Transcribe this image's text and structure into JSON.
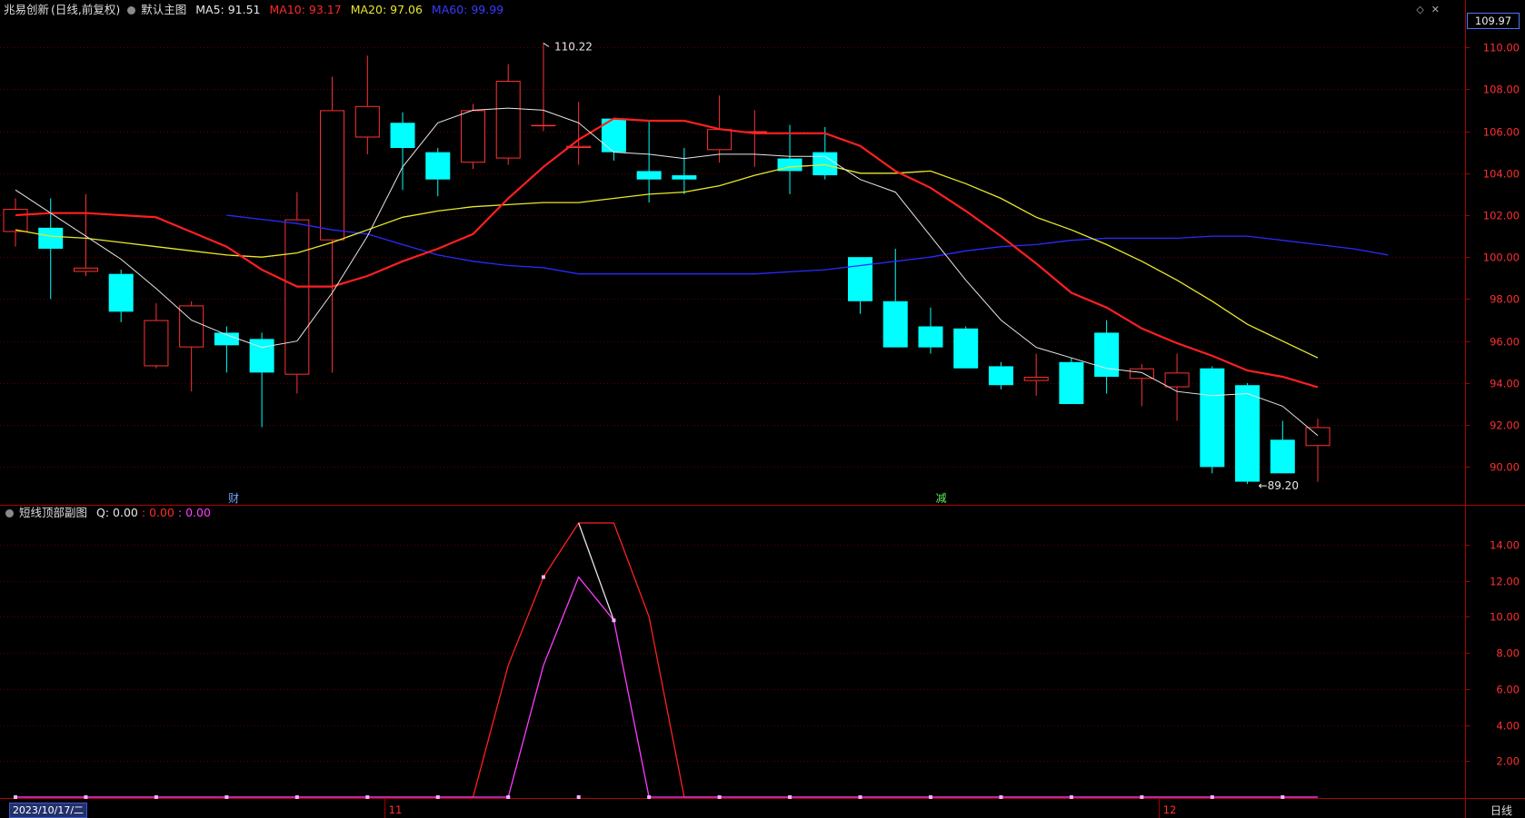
{
  "header_main": {
    "stock_name": "兆易创新",
    "mode": "(日线,前复权)",
    "template": "默认主图",
    "ma5": "MA5: 91.51",
    "ma10": "MA10: 93.17",
    "ma20": "MA20: 97.06",
    "ma60": "MA60: 99.99"
  },
  "header_sub": {
    "title": "短线顶部副图",
    "q": "Q: 0.00",
    "v2": ": 0.00",
    "v3": ": 0.00"
  },
  "price_box": "109.97",
  "date_box": "2023/10/17/二",
  "period_box": "日线",
  "annotations": {
    "high": "110.22",
    "low": "89.20",
    "marker1": "财",
    "marker2": "减"
  },
  "colors": {
    "up": "#ff3232",
    "down": "#00ffff",
    "ma5": "#e6e6e6",
    "ma10": "#ff2020",
    "ma20": "#e8e82a",
    "ma60": "#2a2aff",
    "sub_red": "#ff2020",
    "sub_magenta": "#ff3cff",
    "grid": "#5a0000",
    "axis": "#b00000"
  },
  "chart_data": [
    {
      "type": "candlestick",
      "x": [
        1,
        2,
        3,
        4,
        5,
        6,
        7,
        8,
        9,
        10,
        11,
        12,
        13,
        14,
        15,
        16,
        17,
        18,
        19,
        20,
        21,
        22,
        23,
        24,
        25,
        26,
        27,
        28,
        29,
        30,
        31,
        32,
        33,
        34,
        35,
        36,
        37,
        38
      ],
      "month_labels": [
        {
          "at": 11.5,
          "label": "11"
        },
        {
          "at": 33.5,
          "label": "12"
        }
      ],
      "open": [
        101.2,
        101.4,
        99.3,
        99.2,
        94.8,
        95.7,
        96.4,
        96.1,
        94.4,
        100.8,
        105.7,
        106.4,
        105.0,
        104.5,
        104.7,
        106.3,
        105.2,
        106.6,
        104.1,
        103.9,
        105.1,
        106.0,
        104.7,
        105.0,
        100.0,
        97.9,
        96.7,
        96.6,
        94.8,
        94.1,
        95.0,
        96.4,
        94.2,
        93.8,
        94.7,
        93.9,
        91.3,
        91.0
      ],
      "close": [
        102.3,
        100.4,
        99.5,
        97.4,
        97.0,
        97.7,
        95.8,
        94.5,
        101.8,
        107.0,
        107.2,
        105.2,
        103.7,
        107.0,
        108.4,
        106.3,
        105.3,
        105.0,
        103.7,
        103.7,
        106.1,
        106.0,
        104.1,
        103.9,
        97.9,
        95.7,
        95.7,
        94.7,
        93.9,
        94.3,
        93.0,
        94.3,
        94.7,
        94.5,
        90.0,
        89.3,
        89.7,
        91.9
      ],
      "high": [
        102.8,
        102.8,
        103.0,
        99.4,
        97.8,
        97.9,
        96.7,
        96.4,
        103.1,
        108.6,
        109.6,
        106.9,
        105.2,
        107.3,
        109.2,
        110.2,
        107.4,
        106.4,
        106.5,
        105.2,
        107.7,
        107.0,
        106.3,
        106.2,
        100.0,
        100.4,
        97.6,
        96.7,
        95.0,
        95.4,
        95.2,
        97.0,
        94.9,
        95.4,
        94.8,
        94.0,
        92.2,
        92.3
      ],
      "low": [
        100.5,
        98.0,
        99.1,
        96.9,
        94.7,
        93.6,
        94.5,
        91.9,
        93.5,
        94.5,
        104.9,
        103.2,
        102.9,
        104.2,
        104.4,
        106.0,
        104.4,
        104.6,
        102.6,
        103.0,
        104.5,
        104.3,
        103.0,
        103.7,
        97.3,
        97.7,
        95.4,
        94.7,
        93.7,
        93.4,
        93.6,
        93.5,
        92.9,
        92.2,
        89.7,
        89.2,
        89.8,
        89.3
      ],
      "ma5": [
        103.2,
        102.1,
        101.0,
        99.9,
        98.5,
        97.0,
        96.3,
        95.7,
        96.0,
        98.3,
        101.0,
        104.3,
        106.4,
        107.0,
        107.1,
        107.0,
        106.4,
        105.0,
        104.9,
        104.7,
        104.9,
        104.9,
        104.8,
        104.8,
        103.7,
        103.1,
        101.0,
        98.9,
        97.0,
        95.7,
        95.2,
        94.7,
        94.5,
        93.6,
        93.4,
        93.5,
        92.9,
        91.5
      ],
      "ma10": [
        102.0,
        102.1,
        102.1,
        102.0,
        101.9,
        101.2,
        100.5,
        99.4,
        98.6,
        98.6,
        99.1,
        99.8,
        100.4,
        101.1,
        102.8,
        104.3,
        105.6,
        106.6,
        106.5,
        106.5,
        106.1,
        105.9,
        105.9,
        105.9,
        105.3,
        104.1,
        103.3,
        102.2,
        101.0,
        99.7,
        98.3,
        97.6,
        96.6,
        95.9,
        95.3,
        94.6,
        94.3,
        93.8
      ],
      "ma20": [
        101.3,
        101.0,
        100.9,
        100.7,
        100.5,
        100.3,
        100.1,
        100.0,
        100.2,
        100.7,
        101.3,
        101.9,
        102.2,
        102.4,
        102.5,
        102.6,
        102.6,
        102.8,
        103.0,
        103.1,
        103.4,
        103.9,
        104.3,
        104.4,
        104.0,
        104.0,
        104.1,
        103.5,
        102.8,
        101.9,
        101.3,
        100.6,
        99.8,
        98.9,
        97.9,
        96.8,
        96.0,
        95.2
      ],
      "ma60_from": 7,
      "ma60": [
        102.0,
        101.8,
        101.6,
        101.3,
        101.1,
        100.6,
        100.1,
        99.8,
        99.6,
        99.5,
        99.2,
        99.2,
        99.2,
        99.2,
        99.2,
        99.2,
        99.3,
        99.4,
        99.6,
        99.8,
        100.0,
        100.3,
        100.5,
        100.6,
        100.8,
        100.9,
        100.9,
        100.9,
        101.0,
        101.0,
        100.8,
        100.6,
        100.4,
        100.1
      ]
    },
    {
      "type": "line",
      "x": [
        1,
        2,
        3,
        4,
        5,
        6,
        7,
        8,
        9,
        10,
        11,
        12,
        13,
        14,
        15,
        16,
        17,
        18,
        19,
        20,
        21,
        22,
        23,
        24,
        25,
        26,
        27,
        28,
        29,
        30,
        31,
        32,
        33,
        34,
        35,
        36,
        37,
        38
      ],
      "ylim": [
        0,
        15.5
      ],
      "yticks": [
        2,
        4,
        6,
        8,
        10,
        12,
        14
      ],
      "series": [
        {
          "color": "red",
          "values": [
            0,
            0,
            0,
            0,
            0,
            0,
            0,
            0,
            0,
            0,
            0,
            0,
            0,
            0,
            7.3,
            12.2,
            15.2,
            15.2,
            10.0,
            0,
            0,
            0,
            0,
            0,
            0,
            0,
            0,
            0,
            0,
            0,
            0,
            0,
            0,
            0,
            0,
            0,
            0,
            0
          ]
        },
        {
          "color": "magenta",
          "values": [
            0,
            0,
            0,
            0,
            0,
            0,
            0,
            0,
            0,
            0,
            0,
            0,
            0,
            0,
            0,
            7.3,
            12.2,
            9.8,
            0,
            0,
            0,
            0,
            0,
            0,
            0,
            0,
            0,
            0,
            0,
            0,
            0,
            0,
            0,
            0,
            0,
            0,
            0,
            0
          ]
        },
        {
          "color": "white",
          "values": [
            null,
            null,
            null,
            null,
            null,
            null,
            null,
            null,
            null,
            null,
            null,
            null,
            null,
            null,
            null,
            null,
            15.2,
            9.8,
            null,
            null,
            null,
            null,
            null,
            null,
            null,
            null,
            null,
            null,
            null,
            null,
            null,
            null,
            null,
            null,
            null,
            null,
            null,
            null
          ]
        }
      ]
    }
  ],
  "main_axis": {
    "ylim": [
      88.2,
      111.3
    ],
    "yticks": [
      90,
      92,
      94,
      96,
      98,
      100,
      102,
      104,
      106,
      108,
      110
    ]
  }
}
